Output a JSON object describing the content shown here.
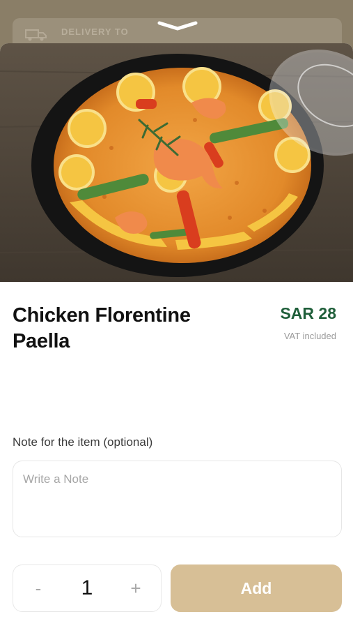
{
  "header": {
    "delivery_label": "DELIVERY TO",
    "delivery_icon": "truck-icon",
    "grabber_icon": "chevron-down-icon"
  },
  "product": {
    "name": "Chicken Florentine Paella",
    "price": "SAR 28",
    "vat_note": "VAT included",
    "image": "paella-dish-photo"
  },
  "note": {
    "label": "Note for the item (optional)",
    "placeholder": "Write a Note",
    "value": ""
  },
  "cart": {
    "minus": "-",
    "plus": "+",
    "quantity": "1",
    "add_label": "Add"
  },
  "colors": {
    "price": "#1f5f3a",
    "add_button": "#d7bf96"
  }
}
